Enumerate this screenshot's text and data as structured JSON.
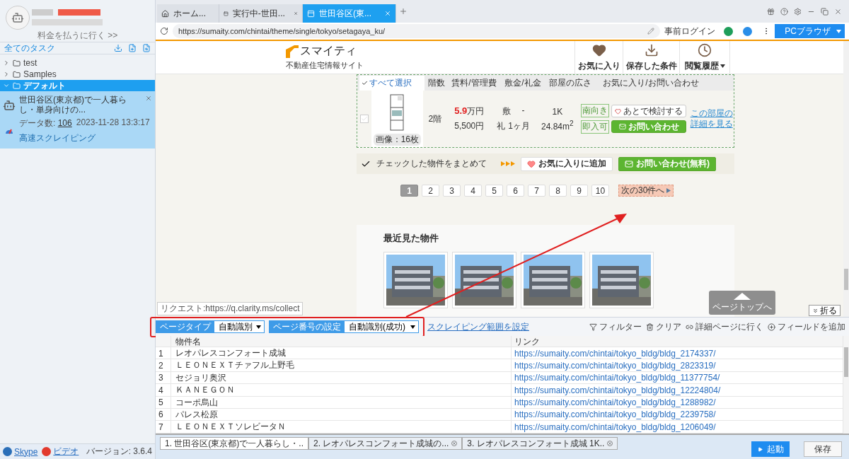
{
  "sidebar": {
    "upgrade_link": "料金を払うに行く >>",
    "all_tasks": "全てのタスク",
    "folders": [
      {
        "label": "test",
        "expanded": false,
        "selected": false
      },
      {
        "label": "Samples",
        "expanded": false,
        "selected": false
      },
      {
        "label": "デフォルト",
        "expanded": true,
        "selected": true,
        "children": [
          {
            "title": "世田谷区(東京都)で一人暮らし・単身向けの...",
            "count_label": "データ数:",
            "count": "106",
            "date": "2023-11-28 13:3:17",
            "mode": "高速スクレイピング"
          }
        ]
      }
    ],
    "footer": {
      "skype": "Skype",
      "video": "ビデオ",
      "version": "バージョン: 3.6.4"
    }
  },
  "browser": {
    "tabs": [
      {
        "label": "ホーム...",
        "kind": "home",
        "selected": false,
        "closable": false
      },
      {
        "label": "実行中-世田...",
        "kind": "page",
        "selected": false,
        "closable": true
      },
      {
        "label": "世田谷区(東...",
        "kind": "page",
        "selected": true,
        "closable": true
      }
    ],
    "url": "https://sumaity.com/chintai/theme/single/tokyo/setagaya_ku/",
    "login": "事前ログイン",
    "mode_button": "PCブラウザ"
  },
  "site": {
    "logo": "スマイティ",
    "tagline": "不動産住宅情報サイト",
    "nav": [
      {
        "label": "お気に入り",
        "kind": "heart",
        "dropdown": false
      },
      {
        "label": "保存した条件",
        "kind": "save",
        "dropdown": false
      },
      {
        "label": "閲覧履歴",
        "kind": "history",
        "dropdown": true
      }
    ],
    "listing": {
      "select_all": "すべて選択",
      "headers": [
        "階数",
        "賃料/管理費",
        "敷金/礼金",
        "部屋の広さ",
        "お気に入り/お問い合わせ"
      ],
      "row": {
        "checked": false,
        "images": "画像：16枚",
        "floor": "2階",
        "rent": "5.9",
        "rent_unit": "万円",
        "fee": "5,500円",
        "deposit_label": "敷",
        "deposit": "-",
        "key_label": "礼",
        "key_money": "1ヶ月",
        "layout": "1K",
        "area": "24.84m$^{2}$",
        "tags": [
          "南向き",
          "即入可"
        ],
        "later": "あとで検討する",
        "contact": "お問い合わせ",
        "detail": "この部屋の詳細を見る"
      }
    },
    "bulk": {
      "label": "チェックした物件をまとめて",
      "favorite": "お気に入りに追加",
      "contact": "お問い合わせ(無料)"
    },
    "pages": [
      {
        "label": "1",
        "selected": true
      },
      {
        "label": "2",
        "selected": false
      },
      {
        "label": "3",
        "selected": false
      },
      {
        "label": "4",
        "selected": false
      },
      {
        "label": "5",
        "selected": false
      },
      {
        "label": "6",
        "selected": false
      },
      {
        "label": "7",
        "selected": false
      },
      {
        "label": "8",
        "selected": false
      },
      {
        "label": "9",
        "selected": false
      },
      {
        "label": "10",
        "selected": false
      }
    ],
    "next": "次の30件へ",
    "recent": {
      "title": "最近見た物件"
    },
    "page_top": "ページトップへ"
  },
  "request": "リクエスト:https://q.clarity.ms/collect",
  "fold": "折る",
  "extract": {
    "page_type_label": "ページタイプ",
    "page_type": "自動識別",
    "page_number_label": "ページ番号の設定",
    "page_number": "自動識別(成功)",
    "range_link": "スクレイピング範囲を設定",
    "actions": [
      {
        "label": "フィルター",
        "kind": "filter"
      },
      {
        "label": "クリア",
        "kind": "clear"
      },
      {
        "label": "詳細ページに行く",
        "kind": "link"
      },
      {
        "label": "フィールドを追加",
        "kind": "add"
      }
    ],
    "columns": [
      "",
      "物件名",
      "リンク"
    ],
    "rows": [
      [
        "1",
        "レオパレスコンフォート成城",
        "https://sumaity.com/chintai/tokyo_bldg/bldg_2174337/"
      ],
      [
        "2",
        "ＬＥＯＮＥＸＴチァフル上野毛",
        "https://sumaity.com/chintai/tokyo_bldg/bldg_2823319/"
      ],
      [
        "3",
        "セジョリ奥沢",
        "https://sumaity.com/chintai/tokyo_bldg/bldg_11377754/"
      ],
      [
        "4",
        "ＫＡＮＥＧＯＮ",
        "https://sumaity.com/chintai/tokyo_bldg/bldg_12224804/"
      ],
      [
        "5",
        "コーポ烏山",
        "https://sumaity.com/chintai/tokyo_bldg/bldg_1288982/"
      ],
      [
        "6",
        "パレス松原",
        "https://sumaity.com/chintai/tokyo_bldg/bldg_2239758/"
      ],
      [
        "7",
        "ＬＥＯＮＥＸＴソレビータＮ",
        "https://sumaity.com/chintai/tokyo_bldg/bldg_1206049/"
      ]
    ]
  },
  "run_tabs": [
    {
      "label": "1. 世田谷区(東京都)で一人暮らし・..",
      "selected": true,
      "closable": false
    },
    {
      "label": "2. レオパレスコンフォート成城の...",
      "selected": false,
      "closable": true
    },
    {
      "label": "3. レオパレスコンフォート成城 1K..",
      "selected": false,
      "closable": true
    }
  ],
  "buttons": {
    "start": "起動",
    "save": "保存"
  }
}
